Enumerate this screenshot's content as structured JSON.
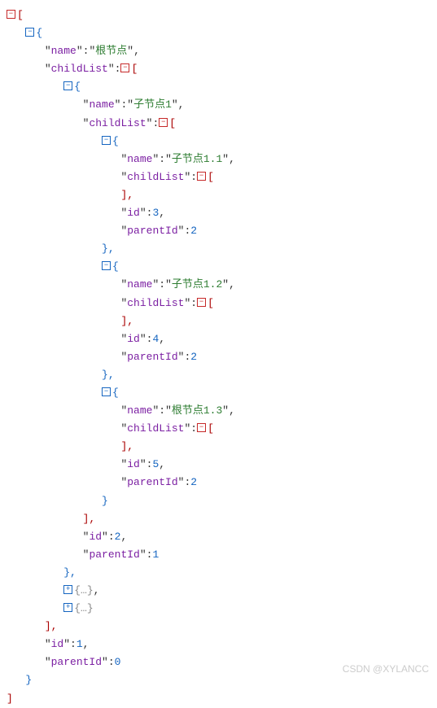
{
  "watermark": "CSDN @XYLANCC",
  "json_tree": {
    "type": "array",
    "children": [
      {
        "type": "object",
        "props": {
          "name": "根节点",
          "id": 1,
          "parentId": 0
        },
        "childList": [
          {
            "type": "object",
            "props": {
              "name": "子节点1",
              "id": 2,
              "parentId": 1
            },
            "childList": [
              {
                "type": "object",
                "props": {
                  "name": "子节点1.1",
                  "id": 3,
                  "parentId": 2
                },
                "childList": []
              },
              {
                "type": "object",
                "props": {
                  "name": "子节点1.2",
                  "id": 4,
                  "parentId": 2
                },
                "childList": []
              },
              {
                "type": "object",
                "props": {
                  "name": "根节点1.3",
                  "id": 5,
                  "parentId": 2
                },
                "childList": []
              }
            ]
          },
          {
            "type": "collapsed"
          },
          {
            "type": "collapsed"
          }
        ]
      }
    ]
  },
  "lines": {
    "l0": "[",
    "l1": "{",
    "l2_k": "name",
    "l2_v": "根节点",
    "l3_k": "childList",
    "l3_v": "[",
    "l4": "{",
    "l5_k": "name",
    "l5_v": "子节点1",
    "l6_k": "childList",
    "l6_v": "[",
    "l7": "{",
    "l8_k": "name",
    "l8_v": "子节点1.1",
    "l9_k": "childList",
    "l9_v": "[",
    "l10": "],",
    "l11_k": "id",
    "l11_v": "3",
    "l12_k": "parentId",
    "l12_v": "2",
    "l13": "},",
    "l14": "{",
    "l15_k": "name",
    "l15_v": "子节点1.2",
    "l16_k": "childList",
    "l16_v": "[",
    "l17": "],",
    "l18_k": "id",
    "l18_v": "4",
    "l19_k": "parentId",
    "l19_v": "2",
    "l20": "},",
    "l21": "{",
    "l22_k": "name",
    "l22_v": "根节点1.3",
    "l23_k": "childList",
    "l23_v": "[",
    "l24": "],",
    "l25_k": "id",
    "l25_v": "5",
    "l26_k": "parentId",
    "l26_v": "2",
    "l27": "}",
    "l28": "],",
    "l29_k": "id",
    "l29_v": "2",
    "l30_k": "parentId",
    "l30_v": "1",
    "l31": "},",
    "l32": "{…}",
    "l33": "{…}",
    "l34": "],",
    "l35_k": "id",
    "l35_v": "1",
    "l36_k": "parentId",
    "l36_v": "0",
    "l37": "}",
    "l38": "]"
  }
}
